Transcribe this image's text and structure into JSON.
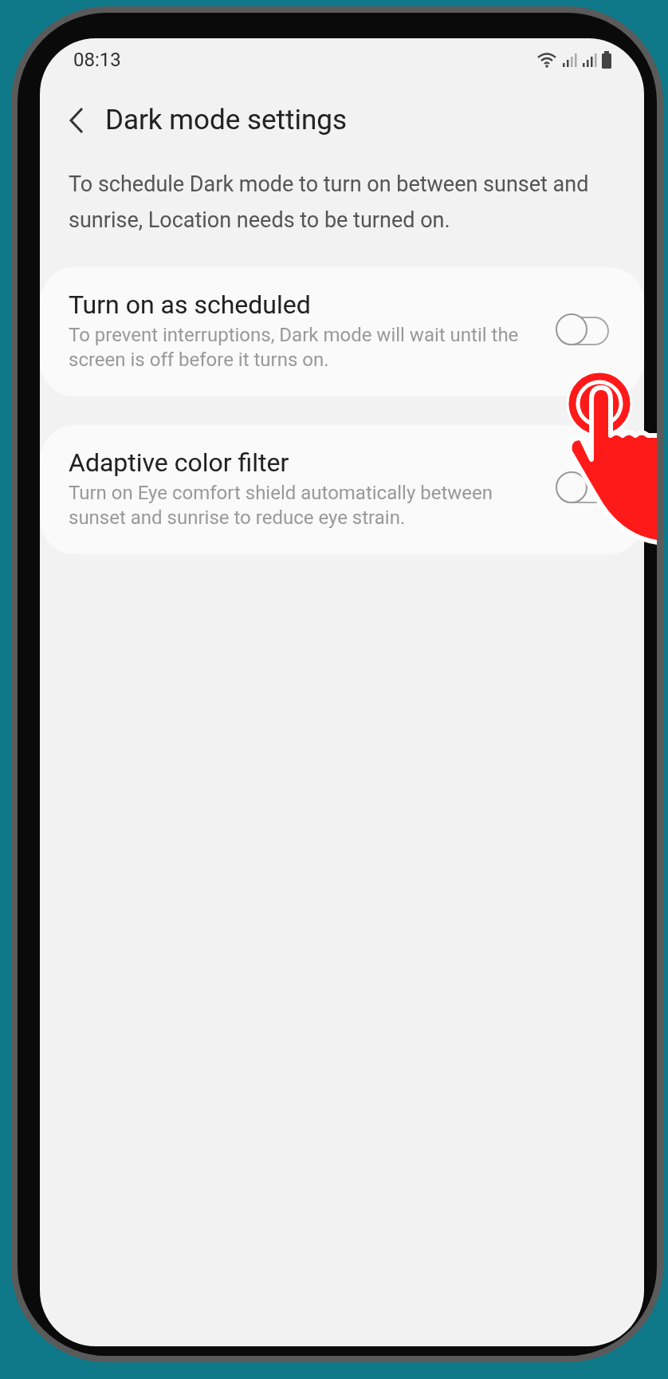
{
  "status_bar": {
    "time": "08:13"
  },
  "header": {
    "title": "Dark mode settings"
  },
  "description": "To schedule Dark mode to turn on between sunset and sunrise, Location needs to be turned on.",
  "settings": [
    {
      "title": "Turn on as scheduled",
      "subtitle": "To prevent interruptions, Dark mode will wait until the screen is off before it turns on.",
      "on": false
    },
    {
      "title": "Adaptive color filter",
      "subtitle": "Turn on Eye comfort shield automatically between sunset and sunrise to reduce eye strain.",
      "on": false
    }
  ]
}
